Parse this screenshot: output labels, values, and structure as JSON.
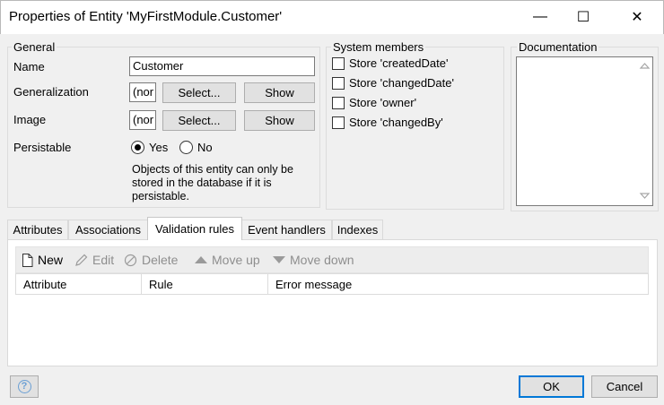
{
  "window": {
    "title": "Properties of Entity 'MyFirstModule.Customer'",
    "minimize_glyph": "—",
    "maximize_glyph": "☐",
    "close_glyph": "✕"
  },
  "general": {
    "group_label": "General",
    "name_label": "Name",
    "name_value": "Customer",
    "generalization_label": "Generalization",
    "generalization_value": "(nor",
    "generalization_select": "Select...",
    "generalization_show": "Show",
    "image_label": "Image",
    "image_value": "(nor",
    "image_select": "Select...",
    "image_show": "Show",
    "persistable_label": "Persistable",
    "yes_label": "Yes",
    "no_label": "No",
    "persistable_selected": "yes",
    "persistable_note": "Objects of this entity can only be stored in the database if it is persistable."
  },
  "system_members": {
    "group_label": "System members",
    "items": [
      {
        "label": "Store 'createdDate'",
        "checked": false
      },
      {
        "label": "Store 'changedDate'",
        "checked": false
      },
      {
        "label": "Store 'owner'",
        "checked": false
      },
      {
        "label": "Store 'changedBy'",
        "checked": false
      }
    ]
  },
  "documentation": {
    "group_label": "Documentation",
    "value": ""
  },
  "tabs": [
    {
      "label": "Attributes",
      "active": false
    },
    {
      "label": "Associations",
      "active": false
    },
    {
      "label": "Validation rules",
      "active": true
    },
    {
      "label": "Event handlers",
      "active": false
    },
    {
      "label": "Indexes",
      "active": false
    }
  ],
  "toolbar": {
    "new_label": "New",
    "edit_label": "Edit",
    "delete_label": "Delete",
    "move_up_label": "Move up",
    "move_down_label": "Move down"
  },
  "grid": {
    "columns": [
      "Attribute",
      "Rule",
      "Error message"
    ],
    "rows": []
  },
  "footer": {
    "help_glyph": "?",
    "ok_label": "OK",
    "cancel_label": "Cancel"
  },
  "colors": {
    "accent": "#0078d7",
    "help_blue": "#6a9fd4",
    "disabled_text": "#8e8e8e"
  }
}
